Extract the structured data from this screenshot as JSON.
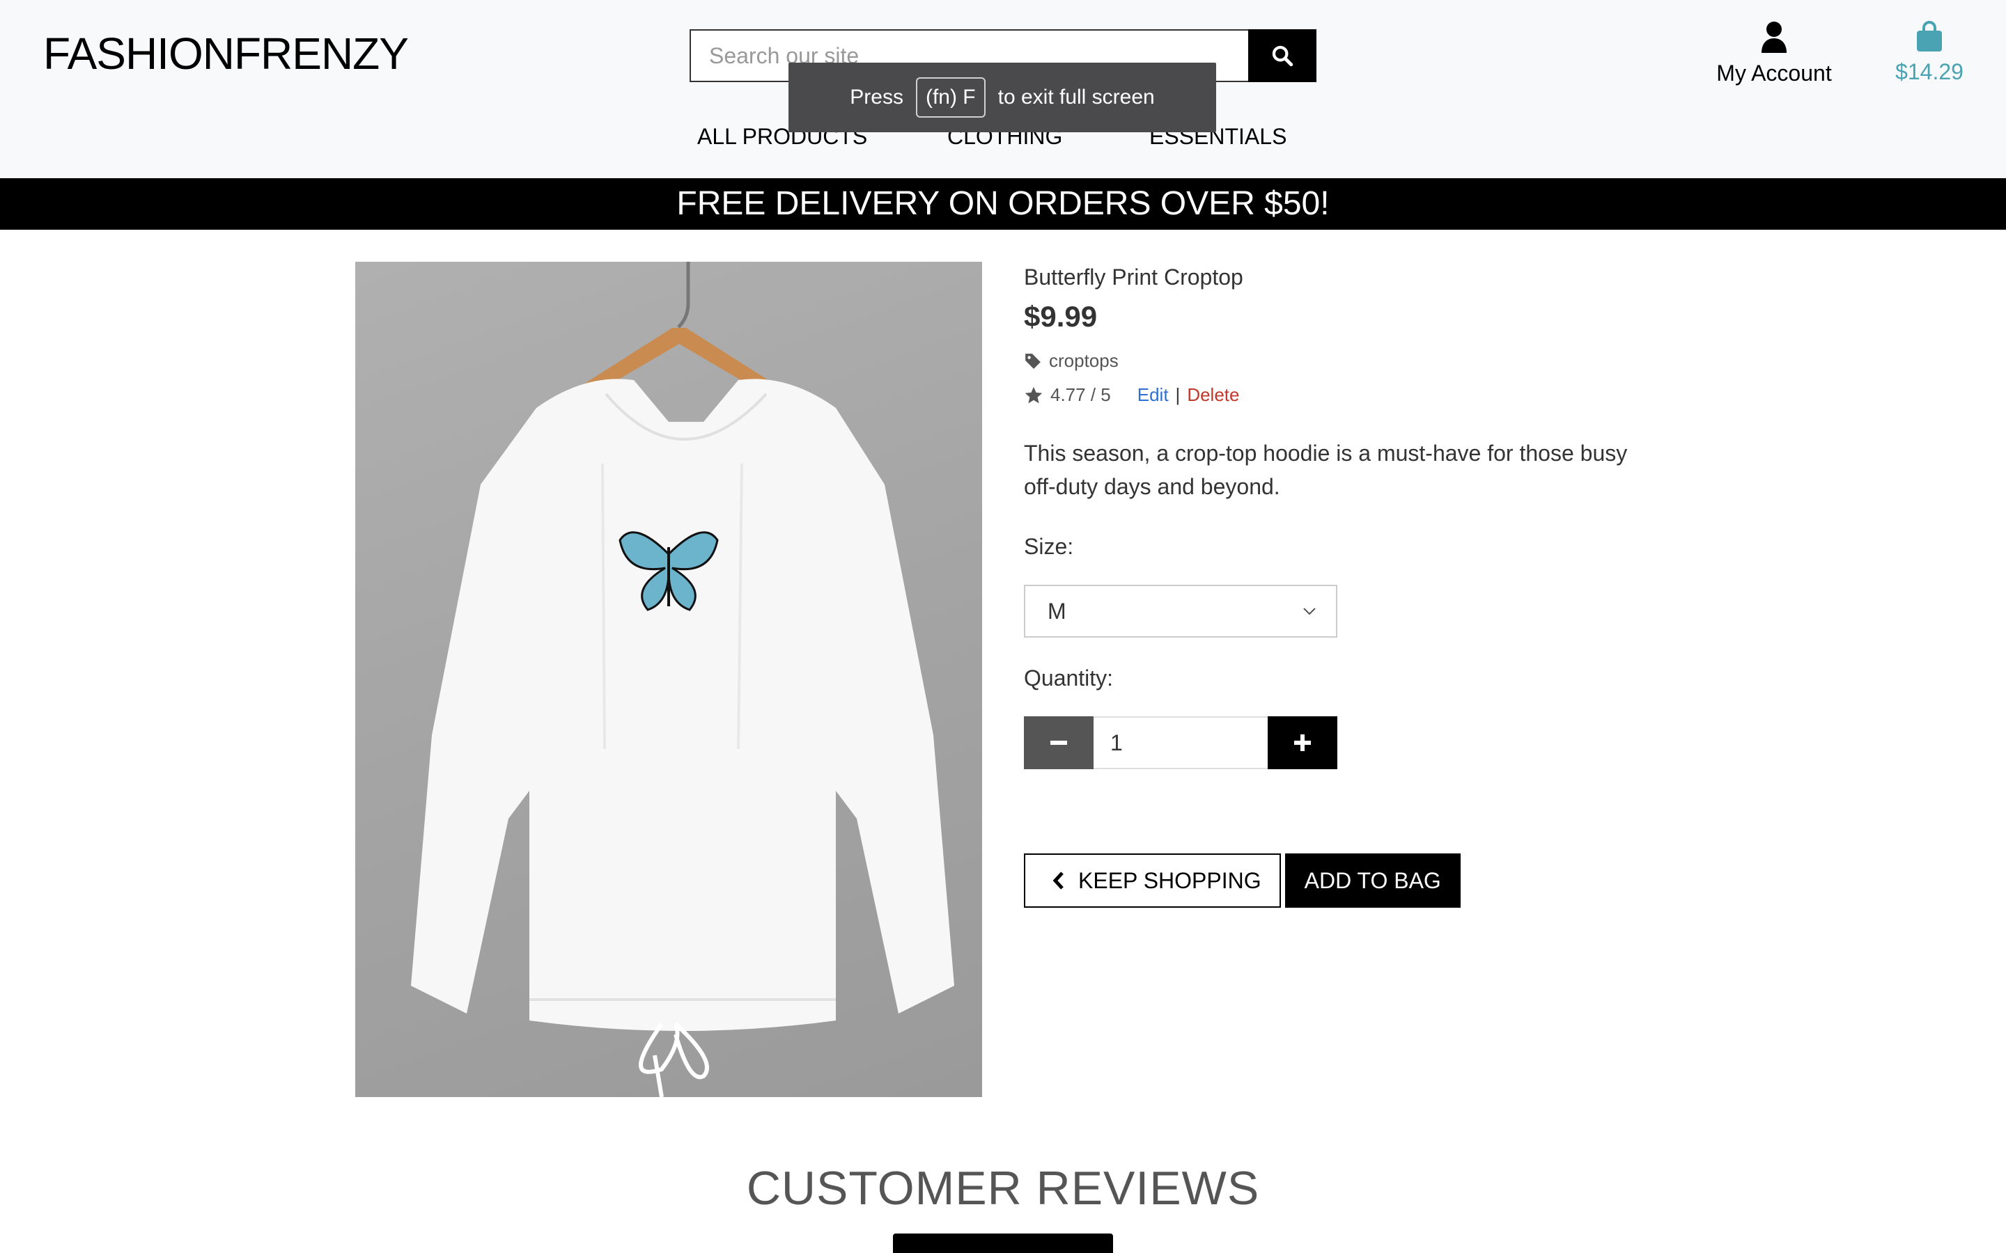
{
  "header": {
    "logo": "FASHIONFRENZY",
    "search": {
      "placeholder": "Search our site"
    },
    "account_label": "My Account",
    "bag_total": "$14.29",
    "nav": [
      "ALL PRODUCTS",
      "CLOTHING",
      "ESSENTIALS"
    ]
  },
  "fullscreen_tip": {
    "prefix": "Press",
    "key": "(fn) F",
    "suffix": "to exit full screen"
  },
  "banner": "FREE DELIVERY ON ORDERS OVER $50!",
  "product": {
    "name": "Butterfly Print Croptop",
    "price": "$9.99",
    "category": "croptops",
    "rating": "4.77 / 5",
    "edit_label": "Edit",
    "separator": "|",
    "delete_label": "Delete",
    "description": "This season, a crop-top hoodie is a must-have for those busy off-duty days and beyond.",
    "size_label": "Size:",
    "size_value": "M",
    "quantity_label": "Quantity:",
    "quantity_value": "1",
    "keep_shopping_label": "KEEP SHOPPING",
    "add_to_bag_label": "ADD TO BAG"
  },
  "reviews": {
    "title": "CUSTOMER REVIEWS"
  },
  "colors": {
    "accent": "#4aa3b2",
    "edit": "#2f6fd1",
    "delete": "#c0392b",
    "banner_bg": "#000000"
  },
  "icons": [
    "search-icon",
    "user-icon",
    "shopping-bag-icon",
    "tag-icon",
    "star-icon",
    "chevron-down-icon",
    "minus-icon",
    "plus-icon",
    "chevron-left-icon"
  ]
}
